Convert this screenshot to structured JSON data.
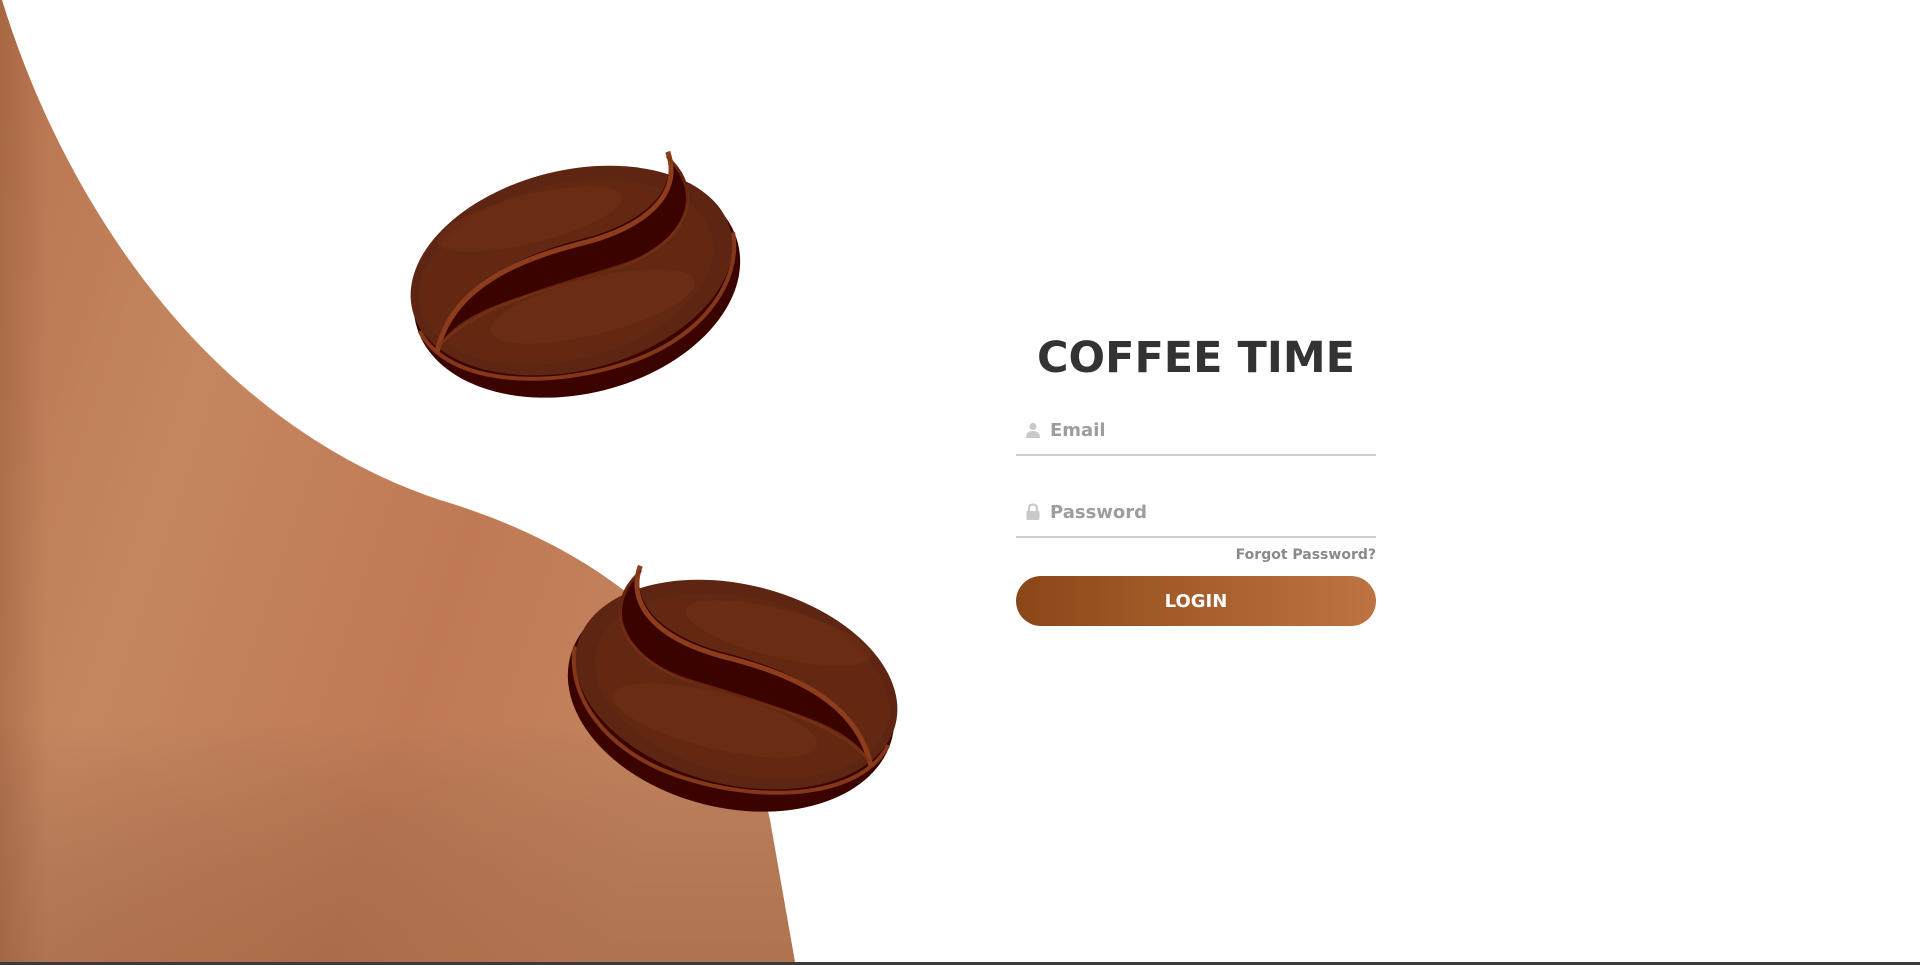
{
  "app": {
    "title": "COFFEE TIME"
  },
  "form": {
    "email_placeholder": "Email",
    "email_value": "",
    "password_placeholder": "Password",
    "password_value": "",
    "forgot_label": "Forgot Password?",
    "login_label": "LOGIN"
  },
  "icons": {
    "email": "user-icon",
    "password": "lock-icon",
    "decor_top": "coffee-bean",
    "decor_bottom": "coffee-bean"
  },
  "colors": {
    "accent_start": "#8a4618",
    "accent_end": "#bd7442",
    "wave": "#c27c57",
    "bean_dark": "#3a0300",
    "bean_body": "#5e2612",
    "title": "#333333"
  }
}
